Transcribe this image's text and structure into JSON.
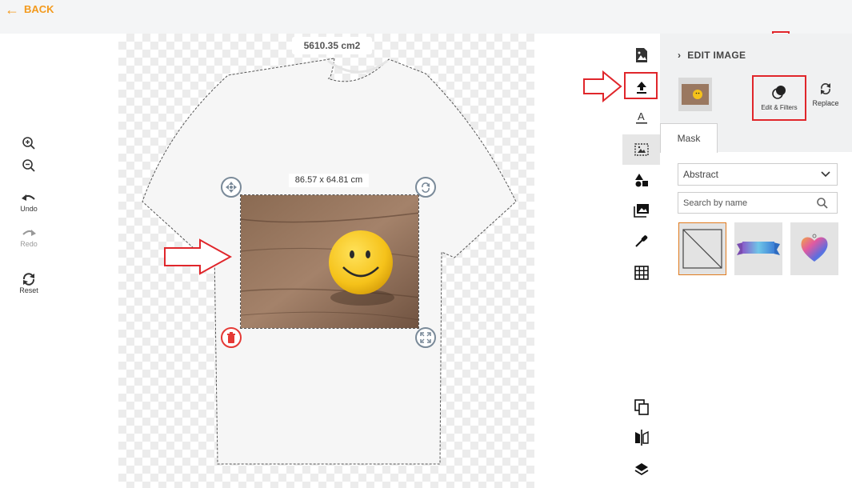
{
  "header": {
    "back_label": "BACK"
  },
  "history_tools": {
    "undo_label": "Undo",
    "redo_label": "Redo",
    "reset_label": "Reset"
  },
  "canvas": {
    "area_label": "5610.35 cm2",
    "image_size_label": "86.57 x 64.81 cm"
  },
  "panel": {
    "title": "EDIT IMAGE",
    "edit_filters_label": "Edit & Filters",
    "replace_label": "Replace",
    "tab_mask": "Mask",
    "category_selected": "Abstract",
    "search_placeholder": "Search by name",
    "masks": [
      "none",
      "ribbon-banner",
      "watercolor-heart"
    ]
  },
  "colors": {
    "accent": "#f39a1d",
    "annotation_red": "#e0262b",
    "delete_red": "#e53935",
    "selected_outline": "#e07b1f"
  }
}
